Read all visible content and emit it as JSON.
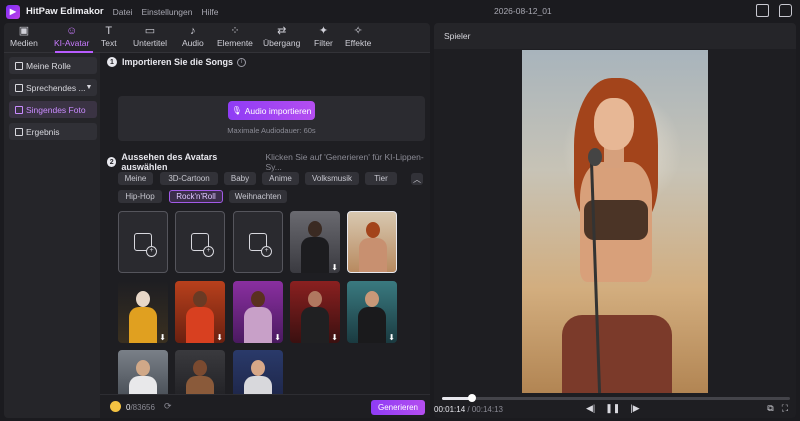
{
  "app": {
    "title": "HitPaw Edimakor",
    "document_title": "2026-08-12_01"
  },
  "menu": [
    "Datei",
    "Einstellungen",
    "Hilfe"
  ],
  "toolbar": {
    "tools": [
      {
        "label": "Medien",
        "icon": "media-icon"
      },
      {
        "label": "KI-Avatar",
        "icon": "avatar-icon"
      },
      {
        "label": "Text",
        "icon": "text-icon"
      },
      {
        "label": "Untertitel",
        "icon": "subtitle-icon"
      },
      {
        "label": "Audio",
        "icon": "music-note-icon"
      },
      {
        "label": "Elemente",
        "icon": "elements-icon"
      },
      {
        "label": "Übergang",
        "icon": "transition-icon"
      },
      {
        "label": "Filter",
        "icon": "filter-icon"
      },
      {
        "label": "Effekte",
        "icon": "effects-icon"
      }
    ],
    "active_tool": "KI-Avatar"
  },
  "sidebar": {
    "items": [
      {
        "label": "Meine Rolle"
      },
      {
        "label": "Sprechendes ..."
      },
      {
        "label": "Singendes Foto"
      },
      {
        "label": "Ergebnis"
      }
    ],
    "active": "Singendes Foto"
  },
  "step1": {
    "number": "1",
    "title": "Importieren Sie die Songs",
    "import_button": "Audio importieren",
    "max_duration": "Maximale Audiodauer: 60s"
  },
  "step2": {
    "number": "2",
    "title": "Aussehen des Avatars auswählen",
    "hint": "Klicken Sie auf 'Generieren' für KI-Lippen-Sy..."
  },
  "tags": [
    "Meine",
    "3D-Cartoon",
    "Baby",
    "Anime",
    "Volksmusik",
    "Tier",
    "Hip-Hop",
    "Rock'n'Roll",
    "Weihnachten"
  ],
  "active_tag": "Rock'n'Roll",
  "footer": {
    "credits_used": "0",
    "credits_total": "/83656",
    "generate_button": "Generieren"
  },
  "player": {
    "label": "Spieler",
    "current_time": "00:01:14",
    "total_time": "/ 00:14:13",
    "progress_fraction": 0.087
  }
}
